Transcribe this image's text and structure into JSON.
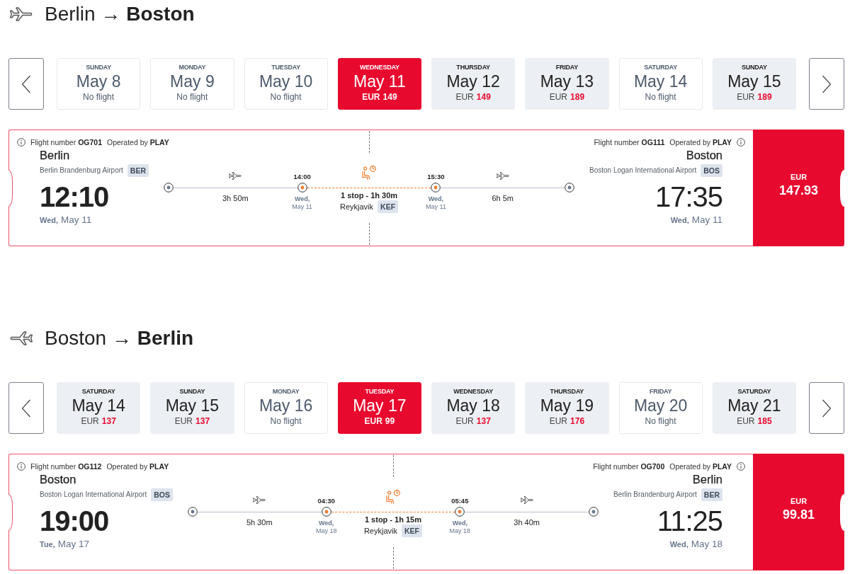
{
  "sections": [
    {
      "kind": "outbound",
      "title": "Berlin → **Boston**",
      "dates": [
        {
          "kind": "no_flight",
          "day": "SUNDAY",
          "date": "May 8",
          "note": "No flight",
          "selected": false
        },
        {
          "kind": "no_flight",
          "day": "MONDAY",
          "date": "May 9",
          "note": "No flight",
          "selected": false
        },
        {
          "kind": "no_flight",
          "day": "TUESDAY",
          "date": "May 10",
          "note": "No flight",
          "selected": false
        },
        {
          "kind": "fare",
          "day": "WEDNESDAY",
          "date": "May 11",
          "currency": "EUR",
          "price": "149",
          "selected": true
        },
        {
          "kind": "fare",
          "day": "THURSDAY",
          "date": "May 12",
          "currency": "EUR",
          "price": "149",
          "selected": false
        },
        {
          "kind": "fare",
          "day": "FRIDAY",
          "date": "May 13",
          "currency": "EUR",
          "price": "189",
          "selected": false
        },
        {
          "kind": "no_flight",
          "day": "SATURDAY",
          "date": "May 14",
          "note": "No flight",
          "selected": false
        },
        {
          "kind": "fare",
          "day": "SUNDAY",
          "date": "May 15",
          "currency": "EUR",
          "price": "189",
          "selected": false
        }
      ],
      "flight": {
        "departure": {
          "flight_number": "Flight number **OG701**",
          "operator": "Operated by **PLAY**",
          "city": "Berlin",
          "airport": "Berlin Brandenburg Airport",
          "code": "BER",
          "time": "12:10",
          "weekday": "Wed,",
          "date": "May 11"
        },
        "legs": [
          {
            "duration": "3h 50m"
          },
          {
            "duration": "6h 5m"
          }
        ],
        "stop": {
          "arrival": {
            "time": "14:00",
            "weekday": "Wed,",
            "date": "May 11"
          },
          "summary": "1 stop - 1h 30m",
          "city": "Reykjavik",
          "code": "KEF",
          "departure": {
            "time": "15:30",
            "weekday": "Wed,",
            "date": "May 11"
          }
        },
        "arrival": {
          "flight_number": "Flight number **OG111**",
          "operator": "Operated by **PLAY**",
          "city": "Boston",
          "airport": "Boston Logan International Airport",
          "code": "BOS",
          "time": "17:35",
          "weekday": "Wed,",
          "date": "May 11"
        },
        "price": {
          "currency": "EUR",
          "amount": "147.93"
        }
      }
    },
    {
      "kind": "inbound",
      "title": "Boston → **Berlin**",
      "dates": [
        {
          "kind": "fare",
          "day": "SATURDAY",
          "date": "May 14",
          "currency": "EUR",
          "price": "137",
          "selected": false
        },
        {
          "kind": "fare",
          "day": "SUNDAY",
          "date": "May 15",
          "currency": "EUR",
          "price": "137",
          "selected": false
        },
        {
          "kind": "no_flight",
          "day": "MONDAY",
          "date": "May 16",
          "note": "No flight",
          "selected": false
        },
        {
          "kind": "fare",
          "day": "TUESDAY",
          "date": "May 17",
          "currency": "EUR",
          "price": "99",
          "selected": true
        },
        {
          "kind": "fare",
          "day": "WEDNESDAY",
          "date": "May 18",
          "currency": "EUR",
          "price": "137",
          "selected": false
        },
        {
          "kind": "fare",
          "day": "THURSDAY",
          "date": "May 19",
          "currency": "EUR",
          "price": "176",
          "selected": false
        },
        {
          "kind": "no_flight",
          "day": "FRIDAY",
          "date": "May 20",
          "note": "No flight",
          "selected": false
        },
        {
          "kind": "fare",
          "day": "SATURDAY",
          "date": "May 21",
          "currency": "EUR",
          "price": "185",
          "selected": false
        }
      ],
      "flight": {
        "departure": {
          "flight_number": "Flight number **OG112**",
          "operator": "Operated by **PLAY**",
          "city": "Boston",
          "airport": "Boston Logan International Airport",
          "code": "BOS",
          "time": "19:00",
          "weekday": "Tue,",
          "date": "May 17"
        },
        "legs": [
          {
            "duration": "5h 30m"
          },
          {
            "duration": "3h 40m"
          }
        ],
        "stop": {
          "arrival": {
            "time": "04:30",
            "weekday": "Wed,",
            "date": "May 18"
          },
          "summary": "1 stop - 1h 15m",
          "city": "Reykjavik",
          "code": "KEF",
          "departure": {
            "time": "05:45",
            "weekday": "Wed,",
            "date": "May 18"
          }
        },
        "arrival": {
          "flight_number": "Flight number **OG700**",
          "operator": "Operated by **PLAY**",
          "city": "Berlin",
          "airport": "Berlin Brandenburg Airport",
          "code": "BER",
          "time": "11:25",
          "weekday": "Wed,",
          "date": "May 18"
        },
        "price": {
          "currency": "EUR",
          "amount": "99.81"
        }
      }
    }
  ]
}
